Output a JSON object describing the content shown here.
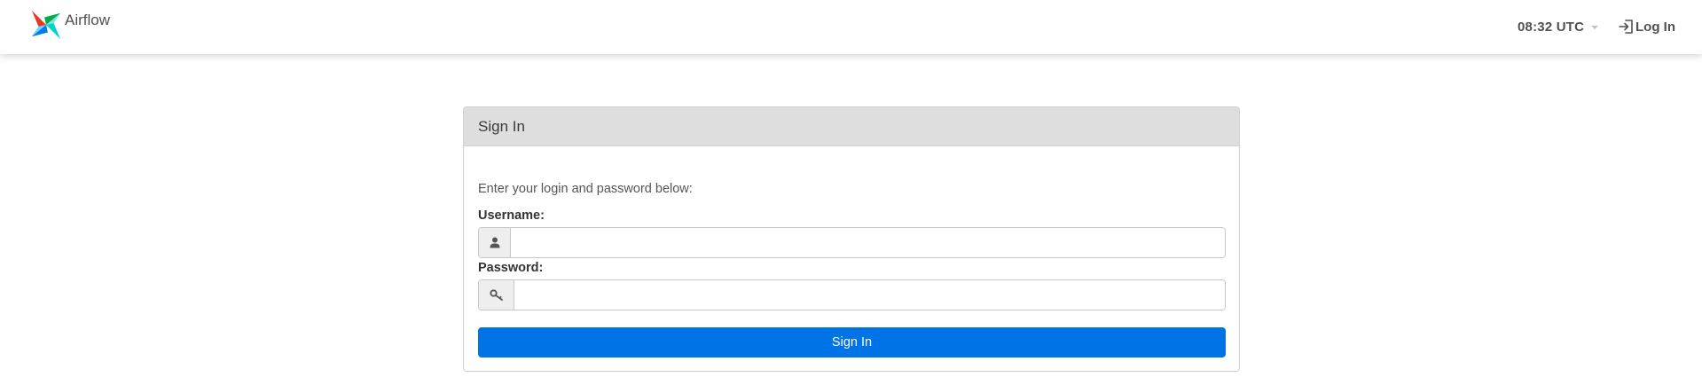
{
  "navbar": {
    "brand": "Airflow",
    "clock": "08:32 UTC",
    "login_label": "Log In"
  },
  "login_form": {
    "title": "Sign In",
    "prompt": "Enter your login and password below:",
    "username_label": "Username:",
    "username_value": "",
    "password_label": "Password:",
    "password_value": "",
    "submit_label": "Sign In"
  },
  "icons": {
    "brand": "airflow-pinwheel-icon",
    "login": "login-arrow-icon",
    "clock_caret": "caret-down-icon",
    "username": "user-icon",
    "password": "key-icon"
  },
  "colors": {
    "primary_button": "#0073e6",
    "panel_heading": "#dedede",
    "text": "#51504f"
  }
}
